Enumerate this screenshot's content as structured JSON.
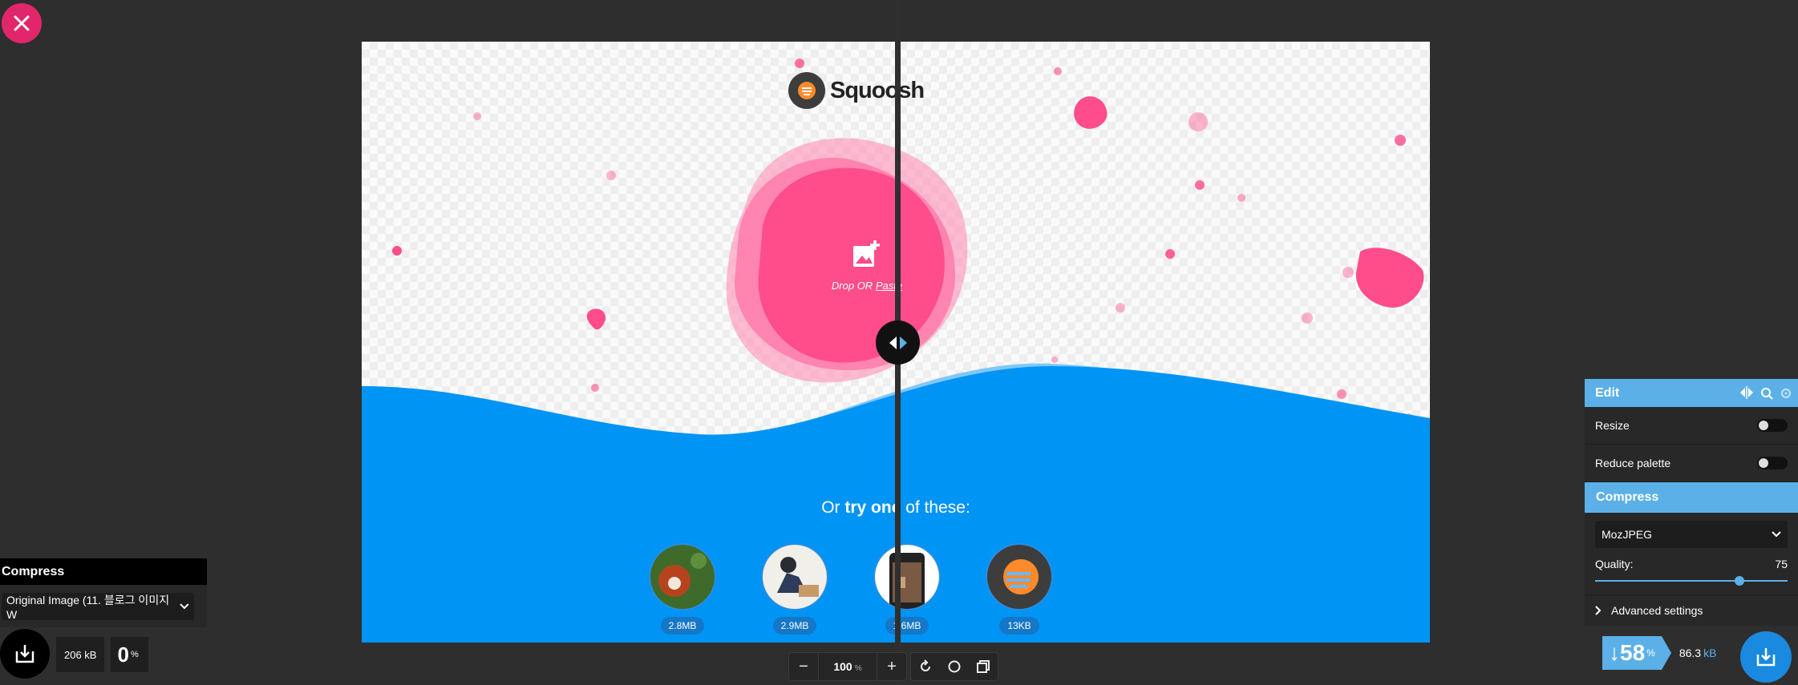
{
  "app": {
    "logo_text": "Squoosh",
    "drop_text": "Drop OR",
    "paste_text": "Paste",
    "try_prefix": "Or",
    "try_bold": "try one",
    "try_suffix": "of these:"
  },
  "samples": [
    {
      "size": "2.8MB",
      "icon": "red-panda-photo"
    },
    {
      "size": "2.9MB",
      "icon": "artist-photo"
    },
    {
      "size": "1.6MB",
      "icon": "phone-screenshot"
    },
    {
      "size": "13KB",
      "icon": "squoosh-logo"
    }
  ],
  "toolbar": {
    "zoom_value": "100",
    "zoom_unit": "%"
  },
  "left_panel": {
    "header": "Compress",
    "selected_option": "Original Image (11. 블로그 이미지 W",
    "file_size": "206 kB",
    "percent": "0",
    "percent_unit": "%"
  },
  "right_panel": {
    "edit_header": "Edit",
    "resize_label": "Resize",
    "reduce_palette_label": "Reduce palette",
    "compress_header": "Compress",
    "codec": "MozJPEG",
    "quality_label": "Quality:",
    "quality_value": "75",
    "quality_fraction": 0.75,
    "advanced_label": "Advanced settings",
    "reduction_arrow": "↓",
    "reduction_value": "58",
    "reduction_unit": "%",
    "output_size": "86.3",
    "output_unit": "kB"
  },
  "colors": {
    "accent_blue": "#5cb0e8",
    "wave_blue": "#0094f5",
    "pink": "#ff4c8b",
    "close_red": "#e2266b"
  }
}
